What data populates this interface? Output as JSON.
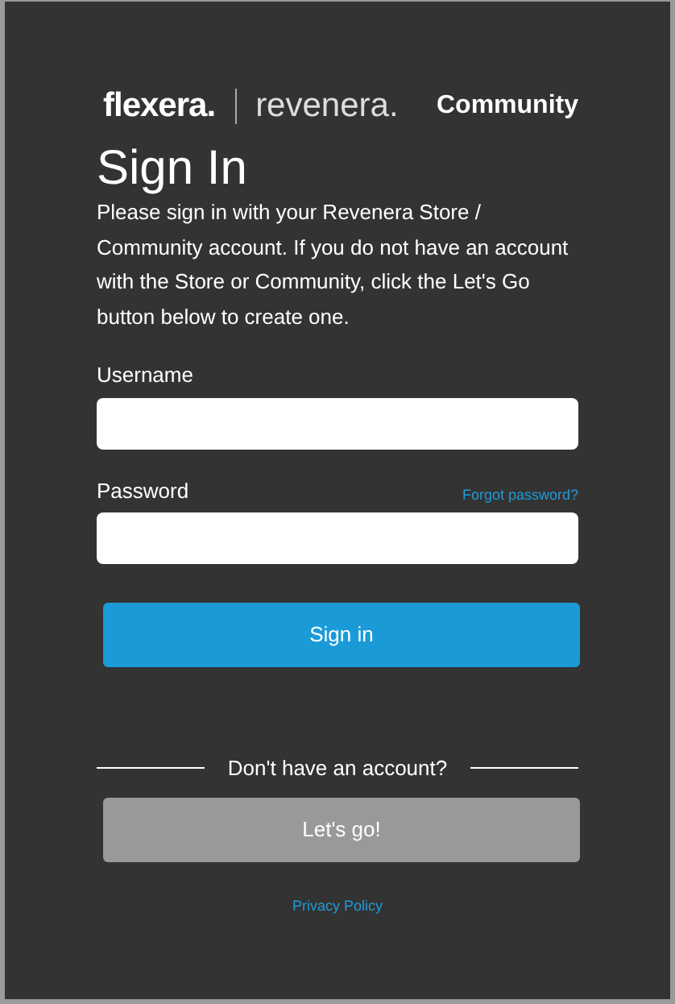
{
  "header": {
    "brand_primary": "flexera.",
    "brand_secondary": "revenera.",
    "section": "Community"
  },
  "title": "Sign In",
  "intro": "Please sign in with your Revenera Store / Community account. If you do not have an account with the Store or Community, click the Let's Go button below to create one.",
  "fields": [
    {
      "label": "Username"
    },
    {
      "label": "Password",
      "link": "Forgot password?"
    }
  ],
  "sign_in_button": "Sign in",
  "divider_text": "Don't have an account?",
  "register_button": "Let's go!",
  "footer_link": "Privacy Policy"
}
